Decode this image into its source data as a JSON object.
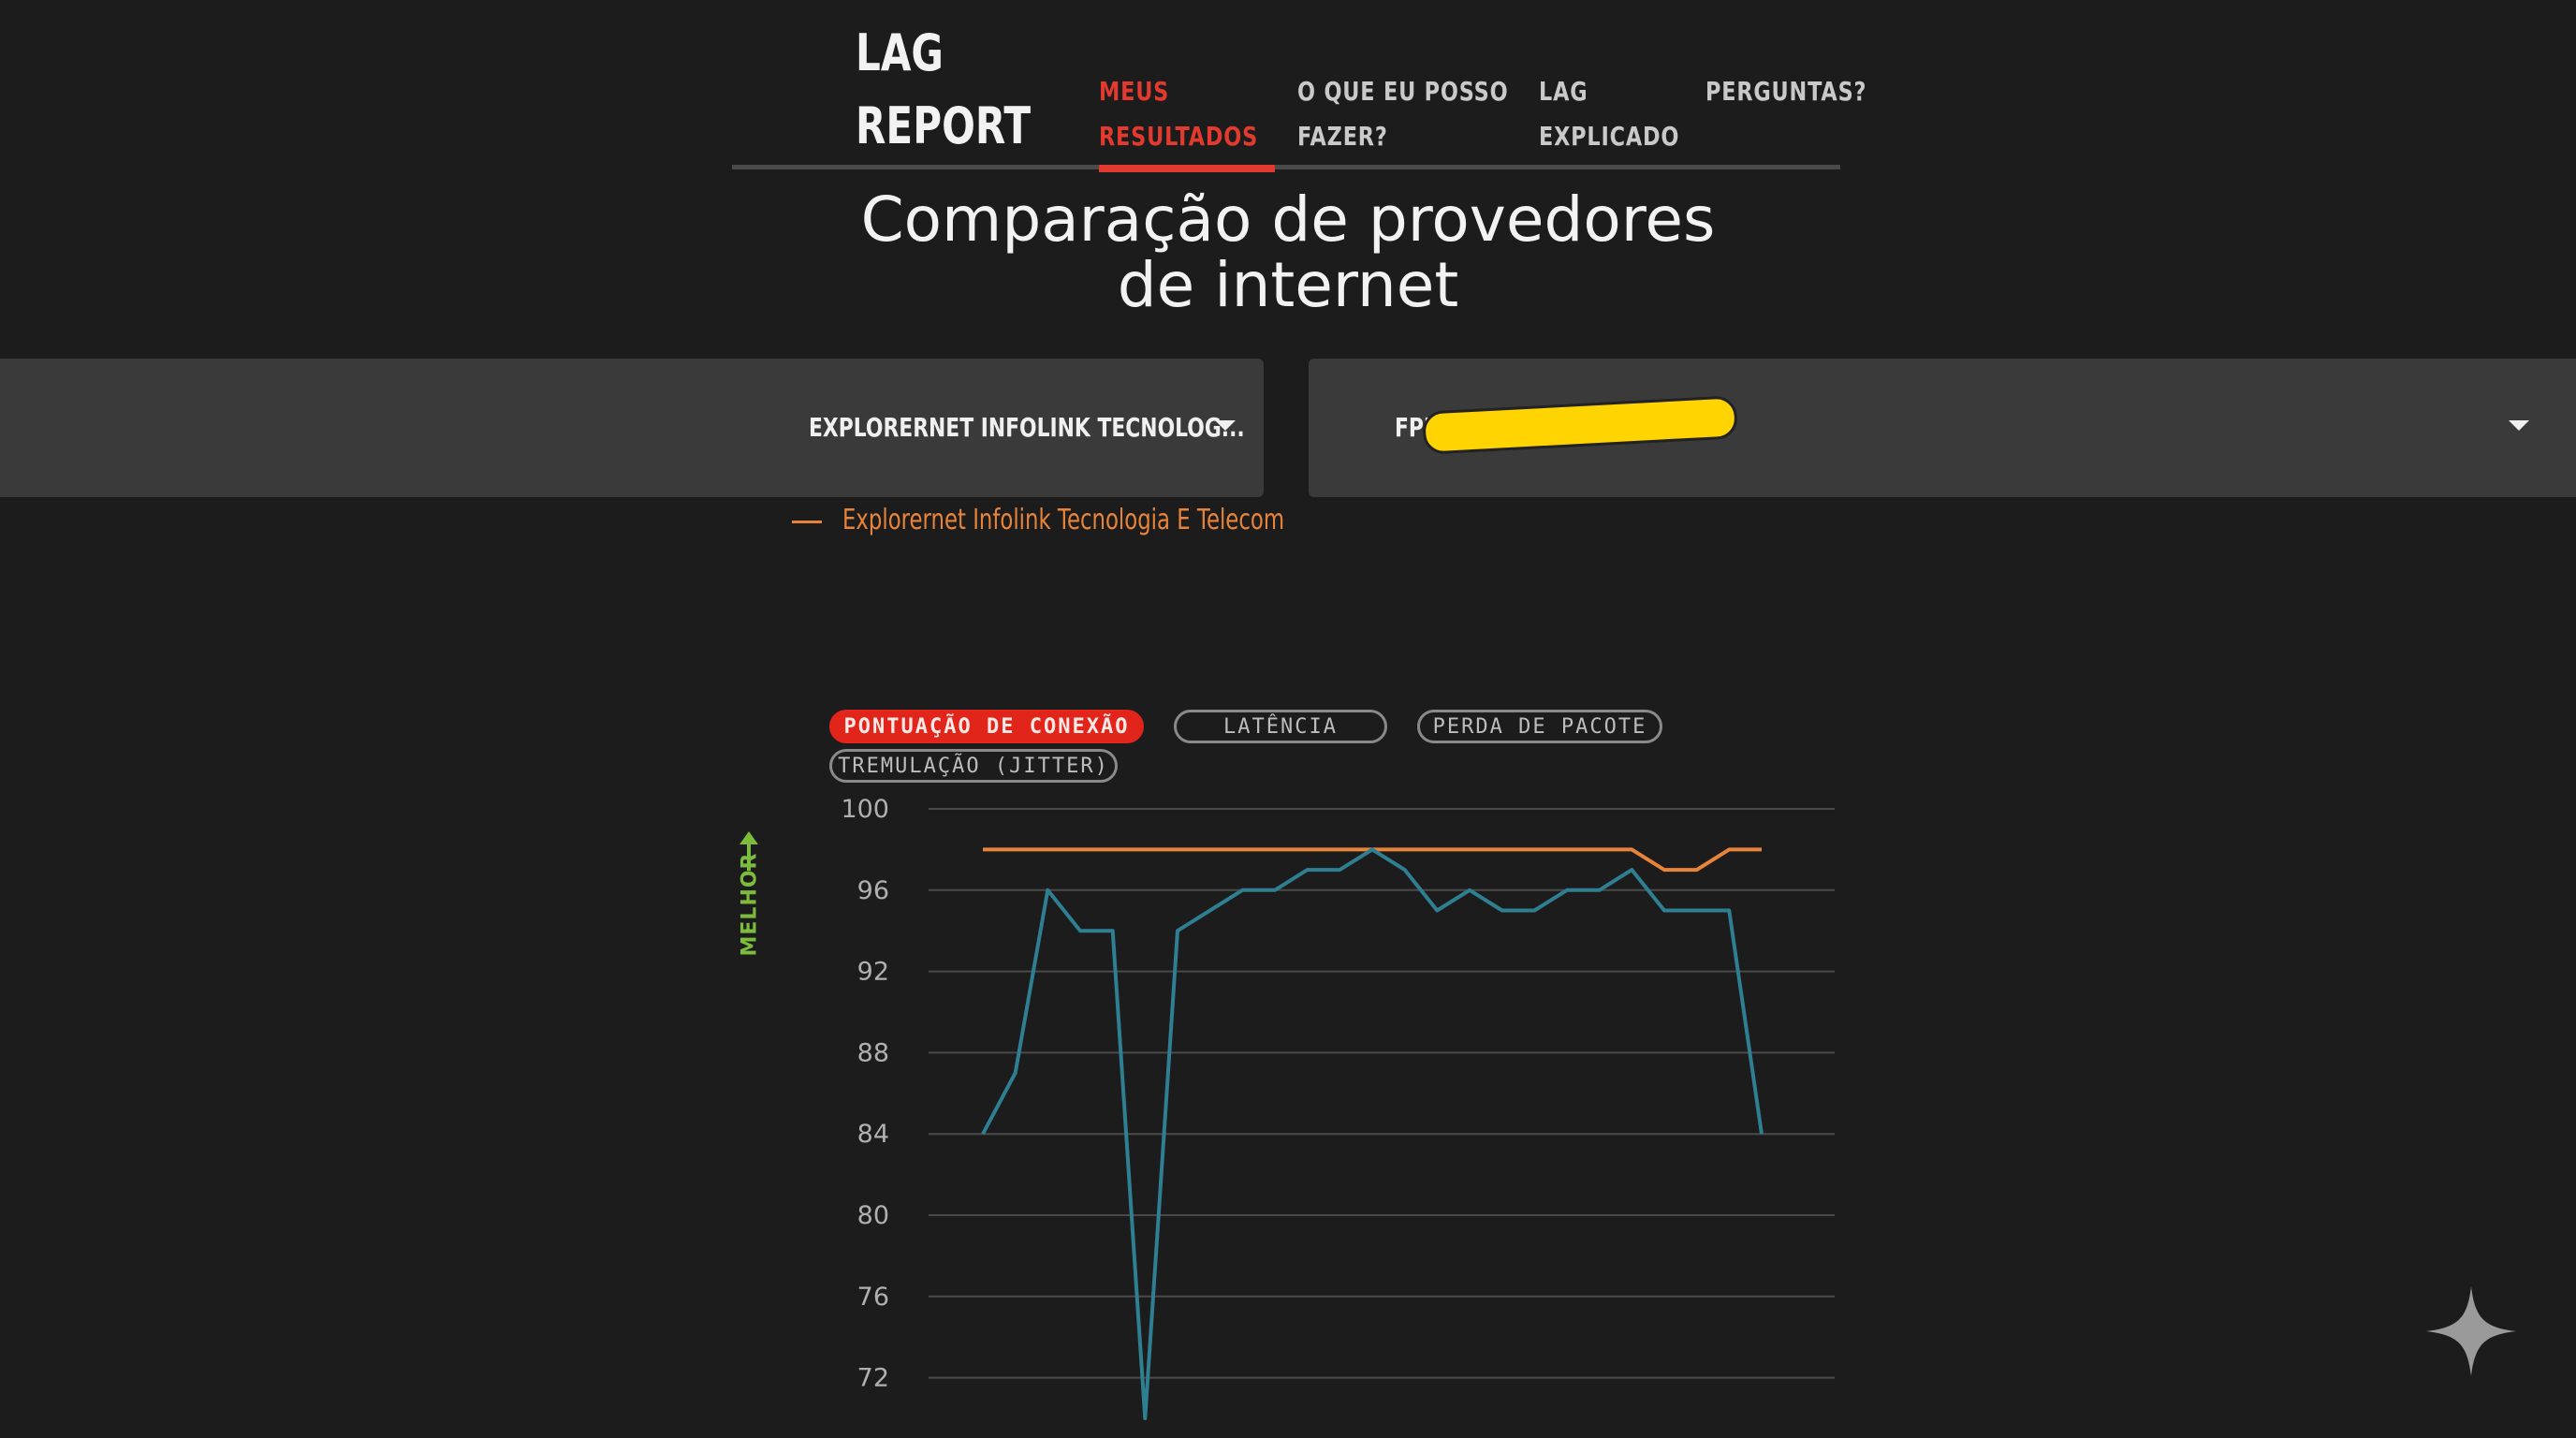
{
  "header": {
    "logo_line1": "LAG",
    "logo_line2": "REPORT",
    "nav": [
      {
        "line1": "MEUS",
        "line2": "RESULTADOS",
        "active": true
      },
      {
        "line1": "O QUE EU POSSO",
        "line2": "FAZER?",
        "active": false
      },
      {
        "line1": "LAG",
        "line2": "EXPLICADO",
        "active": false
      },
      {
        "line1": "PERGUNTAS?",
        "line2": "",
        "active": false
      }
    ]
  },
  "title": {
    "line1": "Comparação de provedores",
    "line2": "de internet"
  },
  "selectors": {
    "left": "EXPLORERNET INFOLINK TECNOLOG...",
    "right": "FPIN"
  },
  "legend": {
    "label": "Explorernet Infolink Tecnologia E Telecom",
    "color": "#e8843a"
  },
  "metric_tabs": [
    {
      "label": "PONTUAÇÃO DE CONEXÃO",
      "active": true
    },
    {
      "label": "LATÊNCIA",
      "active": false
    },
    {
      "label": "PERDA DE PACOTE",
      "active": false
    },
    {
      "label": "TREMULAÇÃO (JITTER)",
      "active": false
    }
  ],
  "better_label": "MELHOR",
  "colors": {
    "accent": "#e1251b",
    "background": "#1c1c1c",
    "series_orange": "#e8843a",
    "series_teal": "#2f7f92",
    "better_green": "#7dbb3c"
  },
  "chart_data": {
    "type": "line",
    "ylim": [
      70,
      100
    ],
    "yticks": [
      100,
      96,
      92,
      88,
      84,
      80,
      76,
      72
    ],
    "grid": true,
    "x": [
      1,
      2,
      3,
      4,
      5,
      6,
      7,
      8,
      9,
      10,
      11,
      12,
      13,
      14,
      15,
      16,
      17,
      18,
      19,
      20,
      21,
      22,
      23,
      24,
      25
    ],
    "series": [
      {
        "name": "Explorernet Infolink Tecnologia E Telecom",
        "color": "#e8843a",
        "values": [
          98,
          98,
          98,
          98,
          98,
          98,
          98,
          98,
          98,
          98,
          98,
          98,
          98,
          98,
          98,
          98,
          98,
          98,
          98,
          98,
          98,
          97,
          97,
          98,
          98
        ]
      },
      {
        "color": "#2f7f92",
        "values": [
          84,
          87,
          96,
          94,
          94,
          70,
          94,
          95,
          96,
          96,
          97,
          97,
          98,
          97,
          95,
          96,
          95,
          95,
          96,
          96,
          97,
          95,
          95,
          95,
          84
        ]
      }
    ]
  }
}
